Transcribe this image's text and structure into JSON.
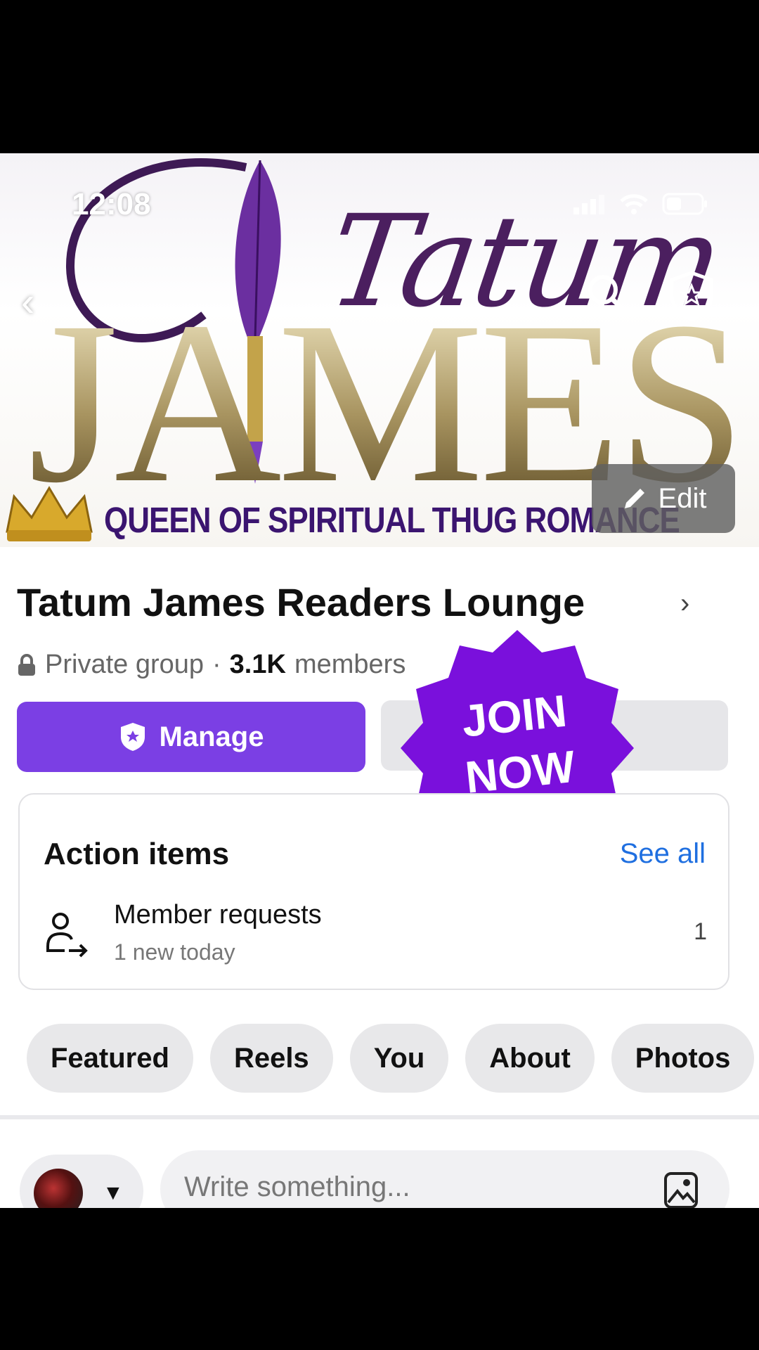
{
  "status": {
    "time": "12:08"
  },
  "cover": {
    "logo_tatum": "Tatum",
    "logo_james": "JAMES",
    "logo_subtitle": "QUEEN OF SPIRITUAL THUG ROMANCE",
    "edit_label": "Edit"
  },
  "group": {
    "title": "Tatum James Readers Lounge",
    "privacy": "Private group",
    "separator": "·",
    "members_count": "3.1K",
    "members_label": "members"
  },
  "buttons": {
    "manage_label": "Manage"
  },
  "badge": {
    "line1": "JOIN",
    "line2": "NOW"
  },
  "action_items": {
    "title": "Action items",
    "see_all": "See all",
    "items": [
      {
        "title": "Member requests",
        "subtitle": "1 new today",
        "count": "1"
      }
    ]
  },
  "tabs": [
    "Featured",
    "Reels",
    "You",
    "About",
    "Photos"
  ],
  "composer": {
    "placeholder": "Write something..."
  },
  "colors": {
    "accent": "#7b3fe4",
    "link": "#1f6fe0",
    "badge": "#7a10dc"
  }
}
